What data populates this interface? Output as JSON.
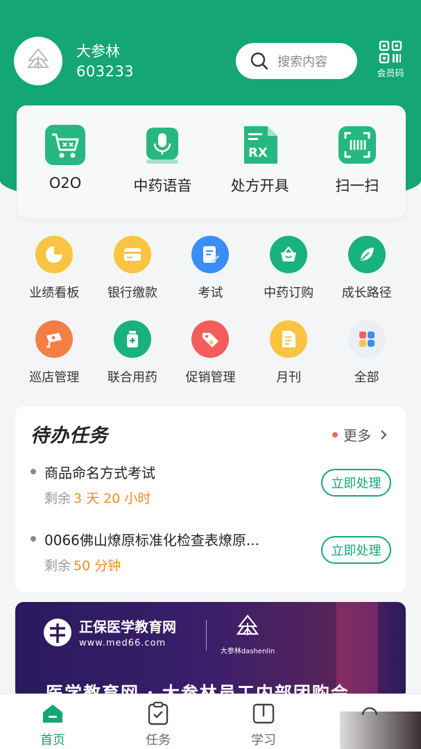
{
  "colors": {
    "brand": "#14a674",
    "accent_orange": "#f08c1e",
    "dot_red": "#f06a5a"
  },
  "header": {
    "store_name": "大参林",
    "store_code": "603233",
    "search_placeholder": "搜索内容",
    "member_code_label": "会员码"
  },
  "quick_actions": [
    {
      "label": "O2O",
      "icon": "cart-icon"
    },
    {
      "label": "中药语音",
      "icon": "microphone-icon"
    },
    {
      "label": "处方开具",
      "icon": "prescription-rx-icon"
    },
    {
      "label": "扫一扫",
      "icon": "scan-icon"
    }
  ],
  "grid": [
    {
      "label": "业绩看板",
      "icon": "pie-chart-icon"
    },
    {
      "label": "银行缴款",
      "icon": "bank-card-icon"
    },
    {
      "label": "考试",
      "icon": "exam-edit-icon"
    },
    {
      "label": "中药订购",
      "icon": "basket-icon"
    },
    {
      "label": "成长路径",
      "icon": "leaf-icon"
    },
    {
      "label": "巡店管理",
      "icon": "camera-surveillance-icon"
    },
    {
      "label": "联合用药",
      "icon": "medicine-bottle-icon"
    },
    {
      "label": "促销管理",
      "icon": "tag-icon"
    },
    {
      "label": "月刊",
      "icon": "document-icon"
    },
    {
      "label": "全部",
      "icon": "all-grid-icon"
    }
  ],
  "todo": {
    "title": "待办任务",
    "more_label": "更多",
    "tasks": [
      {
        "name": "商品命名方式考试",
        "remain_prefix": "剩余",
        "remain_value": "3 天 20 小时",
        "action": "立即处理"
      },
      {
        "name": "0066佛山燎原标准化检查表燎原...",
        "remain_prefix": "剩余",
        "remain_value": "50 分钟",
        "action": "立即处理"
      }
    ]
  },
  "banner": {
    "brand_a": "正保医学教育网",
    "brand_a_url": "www.med66.com",
    "brand_b": "大参林dashenlin",
    "headline": "医学教育网 · 大参林员工内部团购会"
  },
  "tabbar": [
    {
      "label": "首页",
      "icon": "home-icon",
      "active": true
    },
    {
      "label": "任务",
      "icon": "task-clipboard-icon",
      "active": false
    },
    {
      "label": "学习",
      "icon": "book-icon",
      "active": false
    }
  ]
}
